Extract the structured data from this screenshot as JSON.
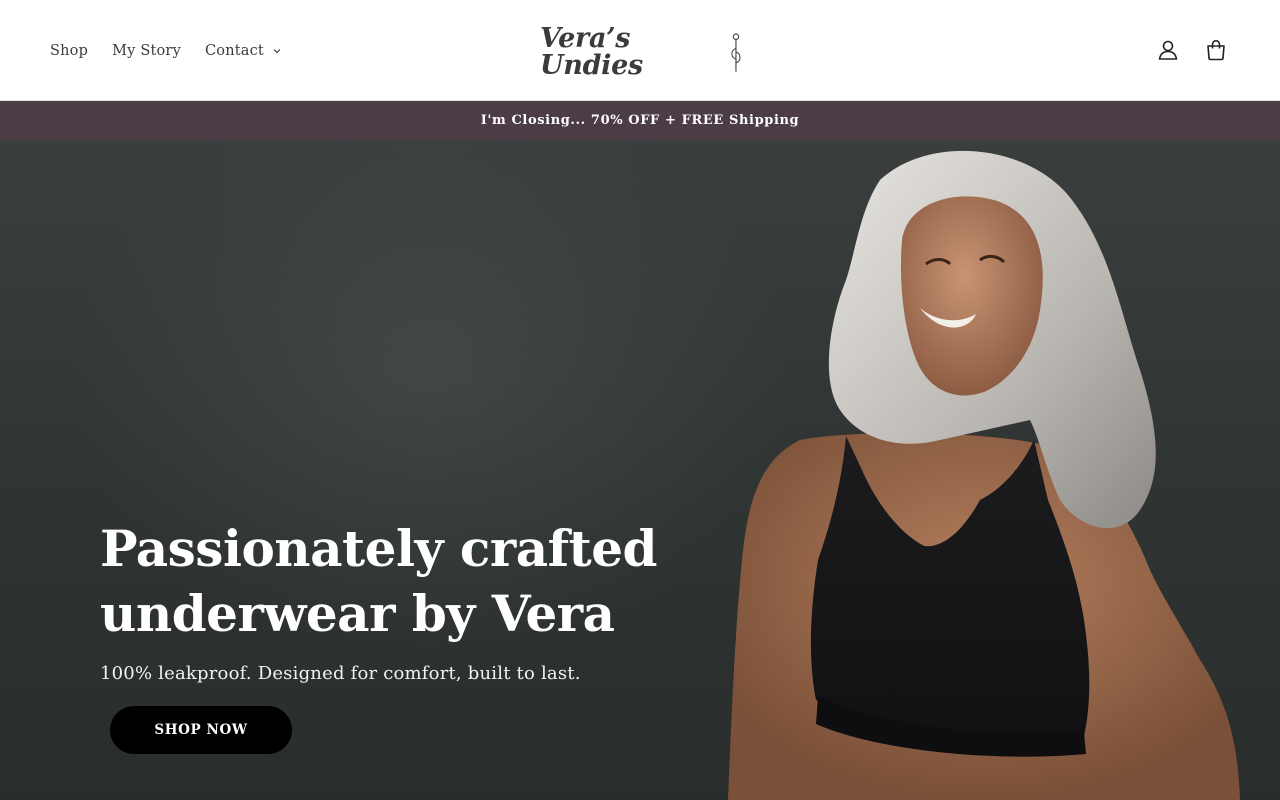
{
  "header": {
    "nav": [
      {
        "label": "Shop"
      },
      {
        "label": "My Story"
      },
      {
        "label": "Contact",
        "has_dropdown": true
      }
    ],
    "logo_text": "Vera’s Undies",
    "icons": [
      "account-icon",
      "cart-icon"
    ]
  },
  "announcement": {
    "text": "I'm Closing... 70% OFF + FREE Shipping",
    "background": "#4b3c45"
  },
  "hero": {
    "heading": "Passionately crafted underwear by Vera",
    "subheading": "100% leakproof. Designed for comfort, built to last.",
    "cta_label": "SHOP NOW",
    "photo_icon": "model-photo"
  },
  "colors": {
    "text_dark": "#3b3b3b",
    "cta_bg": "#000000",
    "hero_bg": "#2f3433"
  }
}
